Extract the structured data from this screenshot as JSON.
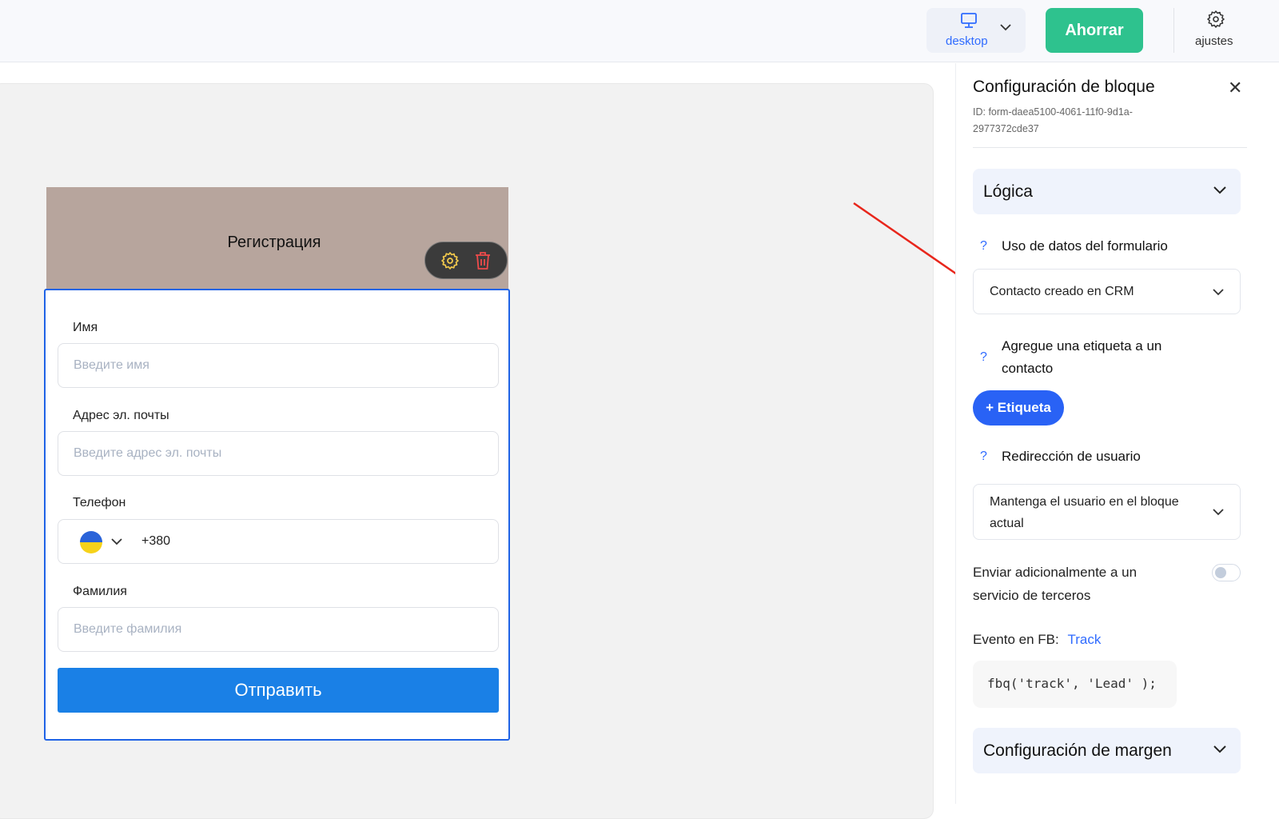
{
  "topbar": {
    "device_label": "desktop",
    "save_label": "Ahorrar",
    "settings_label": "ajustes"
  },
  "form": {
    "title": "Регистрация",
    "fields": [
      {
        "label": "Имя",
        "placeholder": "Введите имя"
      },
      {
        "label": "Адрес эл. почты",
        "placeholder": "Введите адрес эл. почты"
      },
      {
        "label": "Телефон",
        "value": "+380"
      },
      {
        "label": "Фамилия",
        "placeholder": "Введите фамилия"
      }
    ],
    "submit": "Отправить"
  },
  "panel": {
    "title": "Configuración de bloque",
    "id_text": "ID: form-daea5100-4061-11f0-9d1a-2977372cde37",
    "logic_section": "Lógica",
    "q_mark": "?",
    "data_usage_label": "Uso de datos del formulario",
    "data_usage_value": "Contacto creado en CRM",
    "tag_label": "Agregue una etiqueta a un contacto",
    "tag_button": "+ Etiqueta",
    "redirect_label": "Redirección de usuario",
    "redirect_value": "Mantenga el usuario en el bloque actual",
    "third_party_label": "Enviar adicionalmente a un servicio de terceros",
    "third_party_enabled": false,
    "fb_event_label": "Evento en FB:",
    "fb_event_value": "Track",
    "fb_code": "fbq('track', 'Lead' );",
    "margin_section": "Configuración de margen"
  },
  "colors": {
    "accent": "#2962f5",
    "save": "#2ec28e",
    "form_border": "#1f63e6",
    "submit": "#1a80e6",
    "arrow": "#e8261b"
  }
}
